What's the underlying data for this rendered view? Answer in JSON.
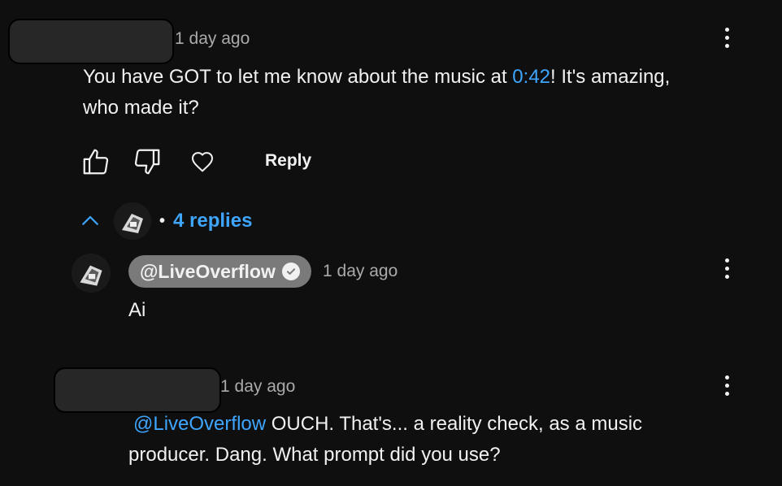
{
  "comment": {
    "time": "1 day ago",
    "text_before": "You have GOT to let me know about the music at ",
    "timestamp": "0:42",
    "text_after": "! It's amazing,",
    "text_line2": "who made it?",
    "reply_label": "Reply",
    "replies_toggle": "4 replies",
    "bullet": "•"
  },
  "reply1": {
    "author": "@LiveOverflow",
    "time": "1 day ago",
    "text": "Ai"
  },
  "reply2": {
    "time": "1 day ago",
    "mention": "@LiveOverflow",
    "text_line1": " OUCH. That's... a reality check, as a music",
    "text_line2": "producer. Dang. What prompt did you use?"
  },
  "colors": {
    "background": "#0f0f0f",
    "link": "#3ea6ff",
    "secondary_text": "#aaaaaa"
  }
}
